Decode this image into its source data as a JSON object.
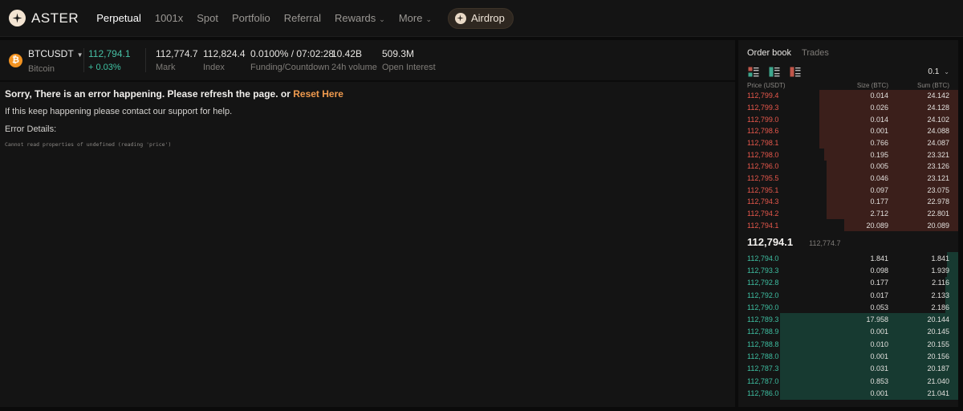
{
  "brand": {
    "name": "ASTER"
  },
  "nav": {
    "items": [
      {
        "label": "Perpetual",
        "active": true
      },
      {
        "label": "1001x"
      },
      {
        "label": "Spot"
      },
      {
        "label": "Portfolio"
      },
      {
        "label": "Referral"
      },
      {
        "label": "Rewards",
        "dropdown": true
      },
      {
        "label": "More",
        "dropdown": true
      }
    ],
    "airdrop_label": "Airdrop"
  },
  "ticker": {
    "symbol": "BTCUSDT",
    "asset_name": "Bitcoin",
    "last_price": "112,794.1",
    "change": "+ 0.03%",
    "stats": [
      {
        "value": "112,774.7",
        "label": "Mark"
      },
      {
        "value": "112,824.4",
        "label": "Index"
      },
      {
        "value": "0.0100% / 07:02:28",
        "label": "Funding/Countdown"
      },
      {
        "value": "10.42B",
        "label": "24h volume"
      },
      {
        "value": "509.3M",
        "label": "Open Interest"
      }
    ]
  },
  "error": {
    "title": "Sorry, There is an error happening. Please refresh the page. or ",
    "reset_link": "Reset Here",
    "help": "If this keep happening please contact our support for help.",
    "details_label": "Error Details:",
    "message": "Cannot read properties of undefined (reading 'price')"
  },
  "orderbook": {
    "tabs": [
      "Order book",
      "Trades"
    ],
    "tick_size": "0.1",
    "headers": {
      "price": "Price (USDT)",
      "size": "Size (BTC)",
      "sum": "Sum (BTC)"
    },
    "asks": [
      {
        "price": "112,799.4",
        "size": "0.014",
        "sum": "24.142",
        "depth": 0.63
      },
      {
        "price": "112,799.3",
        "size": "0.026",
        "sum": "24.128",
        "depth": 0.63
      },
      {
        "price": "112,799.0",
        "size": "0.014",
        "sum": "24.102",
        "depth": 0.63
      },
      {
        "price": "112,798.6",
        "size": "0.001",
        "sum": "24.088",
        "depth": 0.63
      },
      {
        "price": "112,798.1",
        "size": "0.766",
        "sum": "24.087",
        "depth": 0.63
      },
      {
        "price": "112,798.0",
        "size": "0.195",
        "sum": "23.321",
        "depth": 0.61
      },
      {
        "price": "112,796.0",
        "size": "0.005",
        "sum": "23.126",
        "depth": 0.6
      },
      {
        "price": "112,795.5",
        "size": "0.046",
        "sum": "23.121",
        "depth": 0.6
      },
      {
        "price": "112,795.1",
        "size": "0.097",
        "sum": "23.075",
        "depth": 0.6
      },
      {
        "price": "112,794.3",
        "size": "0.177",
        "sum": "22.978",
        "depth": 0.6
      },
      {
        "price": "112,794.2",
        "size": "2.712",
        "sum": "22.801",
        "depth": 0.6
      },
      {
        "price": "112,794.1",
        "size": "20.089",
        "sum": "20.089",
        "depth": 0.52
      }
    ],
    "mid_price": "112,794.1",
    "mark_price": "112,774.7",
    "bids": [
      {
        "price": "112,794.0",
        "size": "1.841",
        "sum": "1.841",
        "depth": 0.05
      },
      {
        "price": "112,793.3",
        "size": "0.098",
        "sum": "1.939",
        "depth": 0.05
      },
      {
        "price": "112,792.8",
        "size": "0.177",
        "sum": "2.116",
        "depth": 0.06
      },
      {
        "price": "112,792.0",
        "size": "0.017",
        "sum": "2.133",
        "depth": 0.06
      },
      {
        "price": "112,790.0",
        "size": "0.053",
        "sum": "2.186",
        "depth": 0.06
      },
      {
        "price": "112,789.3",
        "size": "17.958",
        "sum": "20.144",
        "depth": 0.81
      },
      {
        "price": "112,788.9",
        "size": "0.001",
        "sum": "20.145",
        "depth": 0.81
      },
      {
        "price": "112,788.8",
        "size": "0.010",
        "sum": "20.155",
        "depth": 0.81
      },
      {
        "price": "112,788.0",
        "size": "0.001",
        "sum": "20.156",
        "depth": 0.81
      },
      {
        "price": "112,787.3",
        "size": "0.031",
        "sum": "20.187",
        "depth": 0.81
      },
      {
        "price": "112,787.0",
        "size": "0.853",
        "sum": "21.040",
        "depth": 0.81
      },
      {
        "price": "112,786.0",
        "size": "0.001",
        "sum": "21.041",
        "depth": 0.81
      }
    ]
  },
  "colors": {
    "ask": "#e8584c",
    "bid": "#3ebfa2",
    "accent": "#ef9a4e"
  }
}
